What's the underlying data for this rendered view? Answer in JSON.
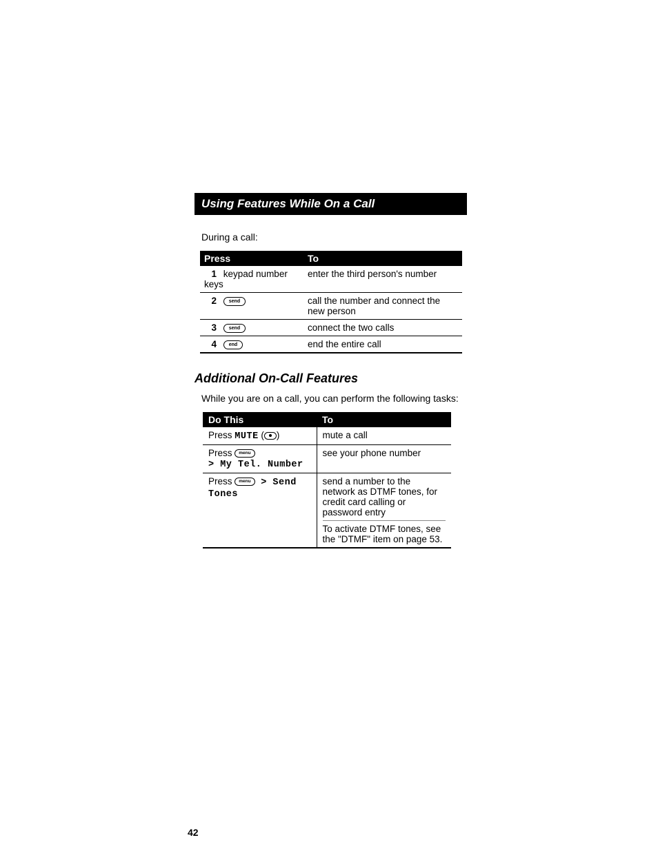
{
  "title": "Using Features While On a Call",
  "intro": "During a call:",
  "table1": {
    "headers": {
      "col1": "Press",
      "col2": "To"
    },
    "rows": [
      {
        "num": "1",
        "press": "keypad number keys",
        "key": "",
        "to": "enter the third person's number"
      },
      {
        "num": "2",
        "press": "",
        "key": "send",
        "to": "call the number and connect the new person"
      },
      {
        "num": "3",
        "press": "",
        "key": "send",
        "to": "connect the two calls"
      },
      {
        "num": "4",
        "press": "",
        "key": "end",
        "to": "end the entire call"
      }
    ]
  },
  "section_heading": "Additional On-Call Features",
  "body_text": "While you are on a call, you can perform the following tasks:",
  "table2": {
    "headers": {
      "col1": "Do This",
      "col2": "To"
    },
    "rows": [
      {
        "dothis_prefix": "Press ",
        "mute": "MUTE",
        "dothis_paren_open": " (",
        "dothis_paren_close": ")",
        "key": "",
        "menupath": "",
        "to": "mute a call",
        "row_type": "mute"
      },
      {
        "dothis_prefix": "Press ",
        "key": "menu",
        "menupath": "> My Tel. Number",
        "to": "see your phone number",
        "row_type": "menu"
      },
      {
        "dothis_prefix": "Press ",
        "key": "menu",
        "menupath_inline": " > Send Tones",
        "to": "send a number to the network as DTMF tones, for credit card calling or password entry",
        "to2": "To activate DTMF tones, see the \"DTMF\" item on page 53.",
        "row_type": "tones"
      }
    ]
  },
  "page_number": "42"
}
